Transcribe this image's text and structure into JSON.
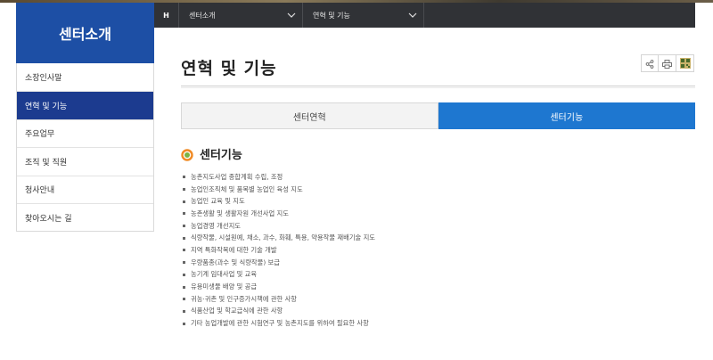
{
  "sidebar": {
    "title": "센터소개",
    "items": [
      {
        "label": "소장인사말",
        "active": false
      },
      {
        "label": "연혁 및 기능",
        "active": true
      },
      {
        "label": "주요업무",
        "active": false
      },
      {
        "label": "조직 및 직원",
        "active": false
      },
      {
        "label": "청사안내",
        "active": false
      },
      {
        "label": "찾아오시는 길",
        "active": false
      }
    ]
  },
  "breadcrumb": {
    "home_label": "H",
    "level1": "센터소개",
    "level2": "연혁 및 기능"
  },
  "page": {
    "title": "연혁 및 기능"
  },
  "tools": {
    "icons": [
      "share-icon",
      "print-icon",
      "qr-icon"
    ]
  },
  "tabs": [
    {
      "label": "센터연혁",
      "active": false
    },
    {
      "label": "센터기능",
      "active": true
    }
  ],
  "section": {
    "heading": "센터기능",
    "items": [
      "농촌지도사업 종합계획 수립, 조정",
      "농업인조직체 및 품목별 농업인 육성 지도",
      "농업인 교육 및 지도",
      "농촌생활 및 생활자원 개선사업 지도",
      "농업경영 개선지도",
      "식량작물, 시설원예, 채소, 과수, 화훼, 특용, 약용작물 재배기술 지도",
      "지역 특화작목에 대한 기술 개발",
      "우량품종(과수 및 식량작물) 보급",
      "농기계 임대사업 및 교육",
      "유용미생물 배양 및 공급",
      "귀농·귀촌 및 인구증가시책에 관한 사항",
      "식품산업 및 학교급식에 관한 사항",
      "기타 농업개발에 관한 시험연구 및 농촌지도를 위하여 필요한 사항"
    ]
  },
  "colors": {
    "sidebar_title_bg": "#1d4fa5",
    "sidebar_active_bg": "#1c3b8f",
    "tab_active_bg": "#1e77d0",
    "breadcrumb_bg": "#303236"
  }
}
